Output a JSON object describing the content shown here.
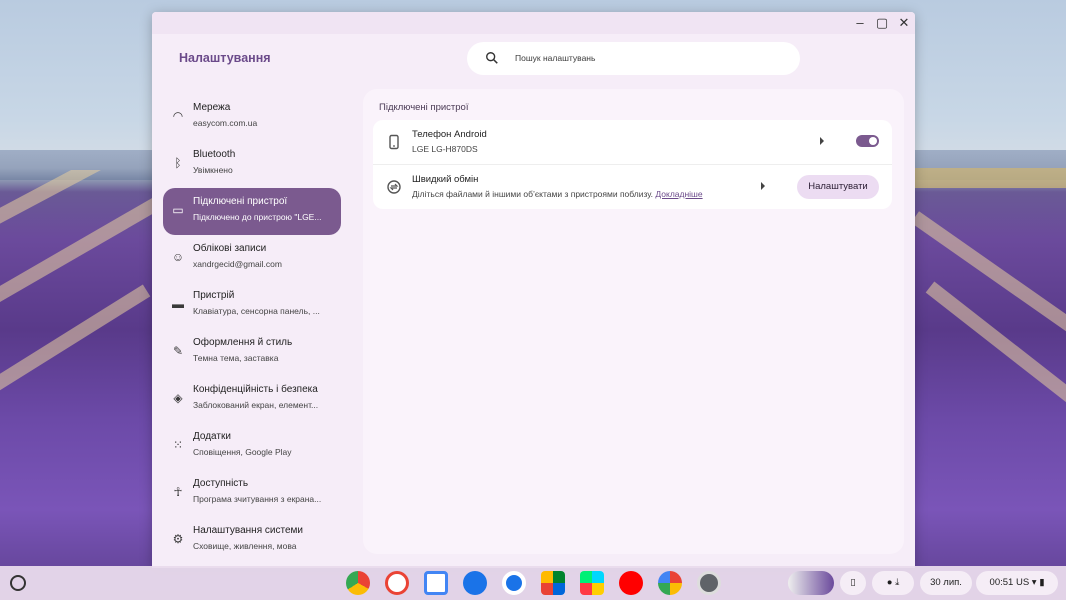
{
  "window": {
    "title": "Налаштування",
    "controls": [
      "minimize-icon",
      "maximize-icon",
      "close-icon"
    ]
  },
  "search": {
    "placeholder": "Пошук налаштувань"
  },
  "sidebar": {
    "items": [
      {
        "label": "Мережа",
        "sub": "easycom.com.ua",
        "icon": "wifi-icon"
      },
      {
        "label": "Bluetooth",
        "sub": "Увімкнено",
        "icon": "bluetooth-icon"
      },
      {
        "label": "Підключені пристрої",
        "sub": "Підключено до пристрою \"LGE...",
        "icon": "connected-devices-icon",
        "active": true
      },
      {
        "label": "Облікові записи",
        "sub": "xandrgecid@gmail.com",
        "icon": "account-icon"
      },
      {
        "label": "Пристрій",
        "sub": "Клавіатура, сенсорна панель, ...",
        "icon": "laptop-icon"
      },
      {
        "label": "Оформлення й стиль",
        "sub": "Темна тема, заставка",
        "icon": "palette-icon"
      },
      {
        "label": "Конфіденційність і безпека",
        "sub": "Заблокований екран, елемент...",
        "icon": "shield-icon"
      },
      {
        "label": "Додатки",
        "sub": "Сповіщення, Google Play",
        "icon": "apps-grid-icon"
      },
      {
        "label": "Доступність",
        "sub": "Програма зчитування з екрана...",
        "icon": "accessibility-icon"
      },
      {
        "label": "Налаштування системи",
        "sub": "Сховище, живлення, мова",
        "icon": "gear-icon"
      }
    ]
  },
  "main": {
    "section_title": "Підключені пристрої",
    "phone": {
      "title": "Телефон Android",
      "sub": "LGE LG-H870DS",
      "toggle_on": true
    },
    "quick_share": {
      "title": "Швидкий обмін",
      "sub": "Діліться файлами й іншими об’єктами з пристроями поблизу.",
      "link": "Докладніше",
      "button": "Налаштувати"
    }
  },
  "shelf": {
    "apps": [
      "chrome-icon",
      "gmail-icon",
      "calendar-icon",
      "files-icon",
      "messages-icon",
      "meet-icon",
      "play-store-icon",
      "youtube-icon",
      "photos-icon",
      "settings-icon"
    ],
    "date": "30 лип.",
    "time": "00:51",
    "locale": "US",
    "accent": "#7b5a8f"
  }
}
